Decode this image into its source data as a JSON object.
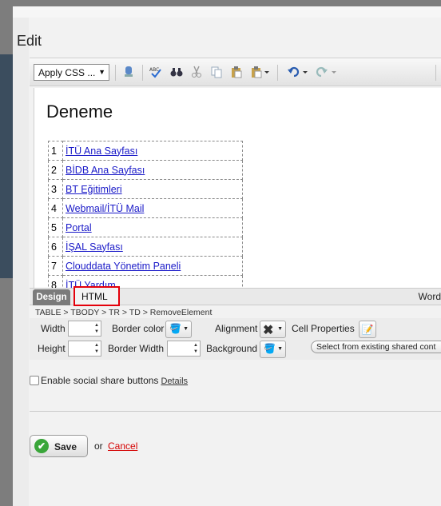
{
  "dialog": {
    "title": "Edit"
  },
  "toolbar": {
    "css_select": "Apply CSS ...",
    "icons": [
      "insert-media-icon",
      "spellcheck-icon",
      "find-icon",
      "cut-icon",
      "copy-icon",
      "paste-icon",
      "paste-dropdown-icon",
      "undo-icon",
      "redo-icon"
    ]
  },
  "editor": {
    "heading": "Deneme",
    "rows": [
      {
        "num": "1",
        "label": "İTÜ Ana Sayfası"
      },
      {
        "num": "2",
        "label": "BİDB Ana Sayfası"
      },
      {
        "num": "3",
        "label": "BT Eğitimleri"
      },
      {
        "num": "4",
        "label": "Webmail/İTÜ Mail"
      },
      {
        "num": "5",
        "label": "Portal"
      },
      {
        "num": "6",
        "label": "İŞAL Sayfası"
      },
      {
        "num": "7",
        "label": "Clouddata Yönetim Paneli"
      },
      {
        "num": "8",
        "label": "İTÜ Yardım"
      }
    ]
  },
  "tabs": {
    "design": "Design",
    "html": "HTML",
    "word": "Word"
  },
  "breadcrumb": "TABLE > TBODY > TR > TD > RemoveElement",
  "props": {
    "width_label": "Width",
    "height_label": "Height",
    "border_color_label": "Border color",
    "border_width_label": "Border Width",
    "alignment_label": "Alignment",
    "background_label": "Background",
    "cell_properties_label": "Cell Properties",
    "shared_button": "Select from existing shared cont"
  },
  "social": {
    "label": "Enable social share buttons",
    "details": "Details"
  },
  "actions": {
    "save": "Save",
    "or": "or",
    "cancel": "Cancel"
  },
  "colors": {
    "link": "#1a1ac8",
    "highlight": "#e4000b",
    "cancel": "#d40000",
    "save_check": "#3aa63a"
  }
}
